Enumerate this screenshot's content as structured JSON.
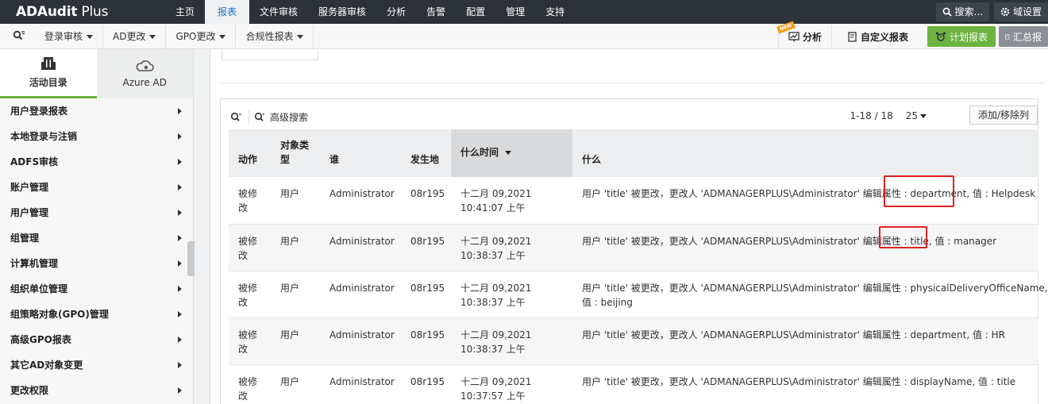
{
  "app": {
    "logo_main": "ADAudit",
    "logo_plus": " Plus"
  },
  "nav": {
    "items": [
      "主页",
      "报表",
      "文件审核",
      "服务器审核",
      "分析",
      "告警",
      "配置",
      "管理",
      "支持"
    ],
    "active_index": 1
  },
  "top_right": {
    "search_label": "搜索...",
    "domain_label": "域设置"
  },
  "subbar": {
    "menus": [
      "登录审核",
      "AD更改",
      "GPO更改",
      "合规性报表"
    ],
    "analysis_label": "分析",
    "new_badge": "NEW",
    "custom_report_label": "自定义报表",
    "schedule_label": "计划报表",
    "summary_label": "汇总报"
  },
  "sidebar": {
    "tabs": [
      {
        "label": "活动目录",
        "icon": "building-icon",
        "active": true
      },
      {
        "label": "Azure AD",
        "icon": "cloud-icon",
        "active": false
      }
    ],
    "items": [
      "用户登录报表",
      "本地登录与注销",
      "ADFS审核",
      "账户管理",
      "用户管理",
      "组管理",
      "计算机管理",
      "组织单位管理",
      "组策略对象(GPO)管理",
      "高级GPO报表",
      "其它AD对象变更",
      "更改权限"
    ]
  },
  "report": {
    "advanced_search_label": "高级搜索",
    "pager_range": "1-18 / 18",
    "page_size": "25",
    "columns_button": "添加/移除列",
    "headers": {
      "action": "动作",
      "object_type": "对象类型",
      "who": "谁",
      "where": "发生地",
      "when": "什么时间",
      "what": "什么"
    },
    "rows": [
      {
        "action": "被修改",
        "object_type": "用户",
        "who": "Administrator",
        "where": "08r195",
        "date": "十二月 09,2021",
        "time": "10:41:07 上午",
        "what": "用户 'title' 被更改，更改人 'ADMANAGERPLUS\\Administrator' 编辑属性 : department, 值 : Helpdesk"
      },
      {
        "action": "被修改",
        "object_type": "用户",
        "who": "Administrator",
        "where": "08r195",
        "date": "十二月 09,2021",
        "time": "10:38:37 上午",
        "what": "用户 'title' 被更改，更改人 'ADMANAGERPLUS\\Administrator' 编辑属性 : title, 值 : manager"
      },
      {
        "action": "被修改",
        "object_type": "用户",
        "who": "Administrator",
        "where": "08r195",
        "date": "十二月 09,2021",
        "time": "10:38:37 上午",
        "what": "用户 'title' 被更改，更改人 'ADMANAGERPLUS\\Administrator' 编辑属性 : physicalDeliveryOfficeName,",
        "what2": "值 : beijing"
      },
      {
        "action": "被修改",
        "object_type": "用户",
        "who": "Administrator",
        "where": "08r195",
        "date": "十二月 09,2021",
        "time": "10:38:37 上午",
        "what": "用户 'title' 被更改，更改人 'ADMANAGERPLUS\\Administrator' 编辑属性 : department, 值 : HR"
      },
      {
        "action": "被修改",
        "object_type": "用户",
        "who": "Administrator",
        "where": "08r195",
        "date": "十二月 09,2021",
        "time": "10:37:57 上午",
        "what": "用户 'title' 被更改，更改人 'ADMANAGERPLUS\\Administrator' 编辑属性 : displayName, 值 : title"
      }
    ]
  },
  "colors": {
    "topbar": "#2d3238",
    "active_nav_text": "#1a73c6",
    "green_button": "#6cb33f",
    "highlight_box": "#e02020"
  }
}
